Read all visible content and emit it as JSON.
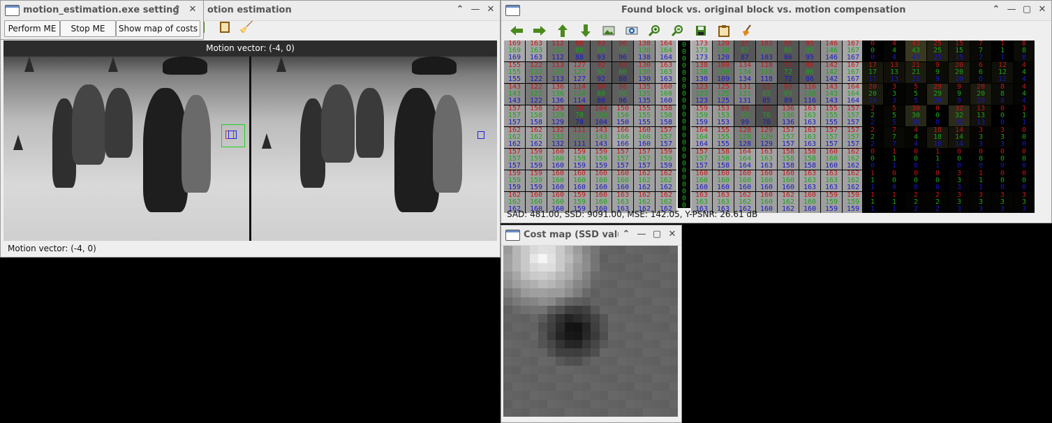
{
  "motion_window": {
    "title": "otion estimation",
    "motion_vector_banner": "Motion vector: (-4, 0)",
    "status": "Motion vector: (-4, 0)"
  },
  "settings_window": {
    "title": "motion_estimation.exe setting",
    "buttons": {
      "perform": "Perform ME",
      "stop": "Stop ME",
      "map": "Show map of costs"
    }
  },
  "found_window": {
    "title": "Found block vs. original block vs. motion compensation",
    "toolbar_icons": [
      "arrow-left-icon",
      "arrow-right-icon",
      "arrow-up-icon",
      "arrow-down-icon",
      "image-icon",
      "zoom-fit-icon",
      "zoom-in-icon",
      "zoom-out-icon",
      "save-icon",
      "copy-icon",
      "clear-icon"
    ],
    "stats": "SAD: 481.00, SSD: 9091.00, MSE: 142.05, Y-PSNR: 26.61 dB",
    "found_block": [
      [
        [
          169,
          169,
          169
        ],
        [
          163,
          163,
          163
        ],
        [
          112,
          112,
          112
        ],
        [
          88,
          88,
          88
        ],
        [
          93,
          93,
          93
        ],
        [
          96,
          96,
          96
        ],
        [
          138,
          138,
          138
        ],
        [
          164,
          164,
          164
        ]
      ],
      [
        [
          155,
          155,
          155
        ],
        [
          122,
          122,
          122
        ],
        [
          113,
          113,
          113
        ],
        [
          127,
          127,
          127
        ],
        [
          92,
          92,
          92
        ],
        [
          80,
          80,
          80
        ],
        [
          130,
          130,
          130
        ],
        [
          163,
          163,
          163
        ]
      ],
      [
        [
          143,
          143,
          143
        ],
        [
          122,
          122,
          122
        ],
        [
          136,
          136,
          136
        ],
        [
          114,
          114,
          114
        ],
        [
          80,
          80,
          80
        ],
        [
          96,
          96,
          96
        ],
        [
          135,
          135,
          135
        ],
        [
          160,
          160,
          160
        ]
      ],
      [
        [
          157,
          157,
          157
        ],
        [
          158,
          158,
          158
        ],
        [
          129,
          129,
          129
        ],
        [
          78,
          78,
          78
        ],
        [
          104,
          104,
          104
        ],
        [
          150,
          150,
          150
        ],
        [
          155,
          155,
          155
        ],
        [
          158,
          158,
          158
        ]
      ],
      [
        [
          162,
          162,
          162
        ],
        [
          162,
          162,
          162
        ],
        [
          132,
          132,
          132
        ],
        [
          111,
          111,
          111
        ],
        [
          143,
          143,
          143
        ],
        [
          166,
          166,
          166
        ],
        [
          160,
          160,
          160
        ],
        [
          157,
          157,
          157
        ]
      ],
      [
        [
          157,
          157,
          157
        ],
        [
          159,
          159,
          159
        ],
        [
          160,
          160,
          160
        ],
        [
          159,
          159,
          159
        ],
        [
          159,
          159,
          159
        ],
        [
          157,
          157,
          157
        ],
        [
          157,
          157,
          157
        ],
        [
          159,
          159,
          159
        ]
      ],
      [
        [
          159,
          159,
          159
        ],
        [
          159,
          159,
          159
        ],
        [
          160,
          160,
          160
        ],
        [
          160,
          160,
          160
        ],
        [
          160,
          160,
          160
        ],
        [
          160,
          160,
          160
        ],
        [
          162,
          162,
          162
        ],
        [
          162,
          162,
          162
        ]
      ],
      [
        [
          162,
          162,
          162
        ],
        [
          160,
          160,
          160
        ],
        [
          160,
          160,
          160
        ],
        [
          159,
          159,
          159
        ],
        [
          160,
          160,
          160
        ],
        [
          163,
          163,
          163
        ],
        [
          162,
          162,
          162
        ],
        [
          162,
          162,
          162
        ]
      ]
    ],
    "original_block": [
      [
        [
          173,
          173,
          173
        ],
        [
          120,
          120,
          120
        ],
        [
          87,
          87,
          87
        ],
        [
          103,
          103,
          103
        ],
        [
          86,
          86,
          86
        ],
        [
          95,
          95,
          95
        ],
        [
          146,
          146,
          146
        ],
        [
          167,
          167,
          167
        ]
      ],
      [
        [
          138,
          138,
          138
        ],
        [
          109,
          109,
          109
        ],
        [
          134,
          134,
          134
        ],
        [
          118,
          118,
          118
        ],
        [
          72,
          72,
          72
        ],
        [
          86,
          86,
          86
        ],
        [
          142,
          142,
          142
        ],
        [
          167,
          167,
          167
        ]
      ],
      [
        [
          123,
          123,
          123
        ],
        [
          125,
          125,
          125
        ],
        [
          131,
          131,
          131
        ],
        [
          85,
          85,
          85
        ],
        [
          89,
          89,
          89
        ],
        [
          116,
          116,
          116
        ],
        [
          143,
          143,
          143
        ],
        [
          164,
          164,
          164
        ]
      ],
      [
        [
          159,
          159,
          159
        ],
        [
          153,
          153,
          153
        ],
        [
          99,
          99,
          99
        ],
        [
          78,
          78,
          78
        ],
        [
          136,
          136,
          136
        ],
        [
          163,
          163,
          163
        ],
        [
          155,
          155,
          155
        ],
        [
          157,
          157,
          157
        ]
      ],
      [
        [
          164,
          164,
          164
        ],
        [
          155,
          155,
          155
        ],
        [
          128,
          128,
          128
        ],
        [
          129,
          129,
          129
        ],
        [
          157,
          157,
          157
        ],
        [
          163,
          163,
          163
        ],
        [
          157,
          157,
          157
        ],
        [
          157,
          157,
          157
        ]
      ],
      [
        [
          157,
          157,
          157
        ],
        [
          158,
          158,
          158
        ],
        [
          164,
          164,
          164
        ],
        [
          163,
          163,
          163
        ],
        [
          158,
          158,
          158
        ],
        [
          158,
          158,
          158
        ],
        [
          160,
          160,
          160
        ],
        [
          162,
          162,
          162
        ]
      ],
      [
        [
          160,
          160,
          160
        ],
        [
          160,
          160,
          160
        ],
        [
          160,
          160,
          160
        ],
        [
          160,
          160,
          160
        ],
        [
          160,
          160,
          160
        ],
        [
          163,
          163,
          163
        ],
        [
          163,
          163,
          163
        ],
        [
          162,
          162,
          162
        ]
      ],
      [
        [
          163,
          163,
          163
        ],
        [
          163,
          163,
          163
        ],
        [
          162,
          162,
          162
        ],
        [
          160,
          160,
          160
        ],
        [
          162,
          162,
          162
        ],
        [
          160,
          160,
          160
        ],
        [
          159,
          159,
          159
        ],
        [
          159,
          159,
          159
        ]
      ]
    ],
    "difference_block": [
      [
        [
          0,
          0,
          0
        ],
        [
          4,
          4,
          4
        ],
        [
          43,
          43,
          43
        ],
        [
          25,
          25,
          25
        ],
        [
          15,
          15,
          15
        ],
        [
          7,
          7,
          7
        ],
        [
          1,
          1,
          1
        ],
        [
          8,
          8,
          8
        ]
      ],
      [
        [
          17,
          17,
          17
        ],
        [
          13,
          13,
          13
        ],
        [
          21,
          21,
          21
        ],
        [
          9,
          9,
          9
        ],
        [
          20,
          20,
          20
        ],
        [
          6,
          6,
          6
        ],
        [
          12,
          12,
          12
        ],
        [
          4,
          4,
          4
        ]
      ],
      [
        [
          20,
          20,
          20
        ],
        [
          3,
          3,
          3
        ],
        [
          5,
          5,
          5
        ],
        [
          29,
          29,
          29
        ],
        [
          9,
          9,
          9
        ],
        [
          20,
          20,
          20
        ],
        [
          8,
          8,
          8
        ],
        [
          4,
          4,
          4
        ]
      ],
      [
        [
          2,
          2,
          2
        ],
        [
          5,
          5,
          5
        ],
        [
          30,
          30,
          30
        ],
        [
          0,
          0,
          0
        ],
        [
          32,
          32,
          32
        ],
        [
          13,
          13,
          13
        ],
        [
          0,
          0,
          0
        ],
        [
          1,
          1,
          1
        ]
      ],
      [
        [
          2,
          2,
          2
        ],
        [
          7,
          7,
          7
        ],
        [
          4,
          4,
          4
        ],
        [
          18,
          18,
          18
        ],
        [
          14,
          14,
          14
        ],
        [
          3,
          3,
          3
        ],
        [
          3,
          3,
          3
        ],
        [
          0,
          0,
          0
        ]
      ],
      [
        [
          0,
          0,
          0
        ],
        [
          1,
          1,
          1
        ],
        [
          0,
          0,
          0
        ],
        [
          1,
          1,
          1
        ],
        [
          0,
          0,
          0
        ],
        [
          0,
          0,
          0
        ],
        [
          0,
          0,
          0
        ],
        [
          0,
          0,
          0
        ]
      ],
      [
        [
          1,
          1,
          1
        ],
        [
          0,
          0,
          0
        ],
        [
          0,
          0,
          0
        ],
        [
          0,
          0,
          0
        ],
        [
          3,
          3,
          3
        ],
        [
          1,
          1,
          1
        ],
        [
          0,
          0,
          0
        ],
        [
          0,
          0,
          0
        ]
      ],
      [
        [
          1,
          1,
          1
        ],
        [
          1,
          1,
          1
        ],
        [
          2,
          2,
          2
        ],
        [
          2,
          2,
          2
        ],
        [
          3,
          3,
          3
        ],
        [
          3,
          3,
          3
        ],
        [
          3,
          3,
          3
        ],
        [
          3,
          3,
          3
        ]
      ]
    ]
  },
  "cost_window": {
    "title": "Cost map (SSD valu"
  },
  "colors": {
    "red": "#c01818",
    "green": "#1fa01f",
    "blue": "#1818c0",
    "tool_green": "#4a8a1c"
  }
}
